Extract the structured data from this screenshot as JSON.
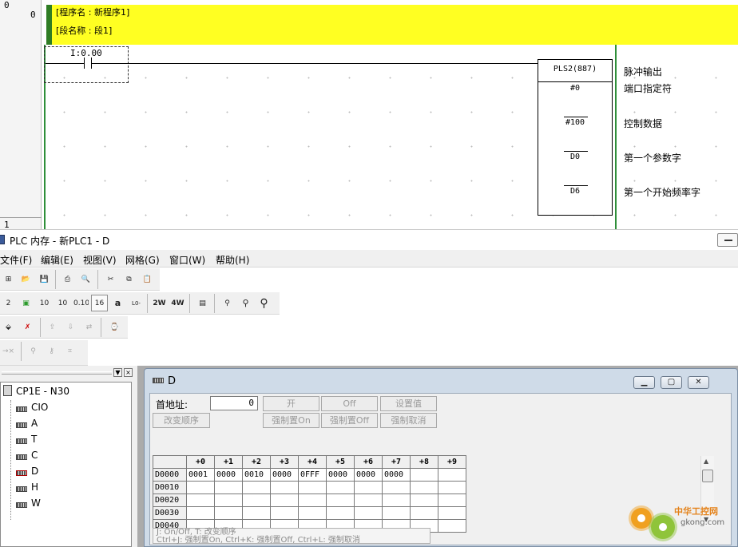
{
  "ladder": {
    "rung0_number": "0",
    "rung1_number": "1",
    "prev_row_number": "0",
    "program_name_line": "[程序名 : 新程序1]",
    "section_name_line": "[段名称 : 段1]",
    "contact_address": "I:0.00",
    "instruction": {
      "name": "PLS2(887)",
      "operands": [
        "#0",
        "#100",
        "D0",
        "D6"
      ]
    },
    "comments": {
      "title": "脉冲输出",
      "operands": [
        "端口指定符",
        "控制数据",
        "第一个参数字",
        "第一个开始频率字"
      ]
    }
  },
  "memory_window": {
    "title": "PLC 内存 - 新PLC1 - D"
  },
  "menu": [
    "文件(F)",
    "编辑(E)",
    "视图(V)",
    "网格(G)",
    "窗口(W)",
    "帮助(H)"
  ],
  "toolbar2": [
    "2",
    "10",
    "10",
    "0.10",
    "16",
    "a",
    "L0-10",
    "2W",
    "4W"
  ],
  "tree": {
    "root": "CP1E - N30",
    "areas": [
      "CIO",
      "A",
      "T",
      "C",
      "D",
      "H",
      "W"
    ],
    "pane_close": "×",
    "pane_menu": "▼"
  },
  "d_window": {
    "title": "D",
    "start_address_label": "首地址:",
    "start_address_value": "0",
    "buttons": {
      "on": "开",
      "off": "Off",
      "set_value": "设置值",
      "change_order": "改变顺序",
      "force_on": "强制置On",
      "force_off": "强制置Off",
      "force_cancel": "强制取消"
    },
    "columns": [
      "+0",
      "+1",
      "+2",
      "+3",
      "+4",
      "+5",
      "+6",
      "+7",
      "+8",
      "+9"
    ],
    "rows": [
      {
        "addr": "D0000",
        "values": [
          "0001",
          "0000",
          "0010",
          "0000",
          "0FFF",
          "0000",
          "0000",
          "0000",
          "",
          ""
        ]
      },
      {
        "addr": "D0010",
        "values": [
          "",
          "",
          "",
          "",
          "",
          "",
          "",
          "",
          "",
          ""
        ]
      },
      {
        "addr": "D0020",
        "values": [
          "",
          "",
          "",
          "",
          "",
          "",
          "",
          "",
          "",
          ""
        ]
      },
      {
        "addr": "D0030",
        "values": [
          "",
          "",
          "",
          "",
          "",
          "",
          "",
          "",
          "",
          ""
        ]
      },
      {
        "addr": "D0040",
        "values": [
          "",
          "",
          "",
          "",
          "",
          "",
          "",
          "",
          "",
          ""
        ]
      }
    ],
    "hint_line1": "J: On/Off,   T: 改变顺序",
    "hint_line2": "Ctrl+J: 强制置On,  Ctrl+K:  强制置Off,  Ctrl+L: 强制取消"
  },
  "watermark": {
    "name": "中华工控网",
    "url": "gkong.com"
  }
}
